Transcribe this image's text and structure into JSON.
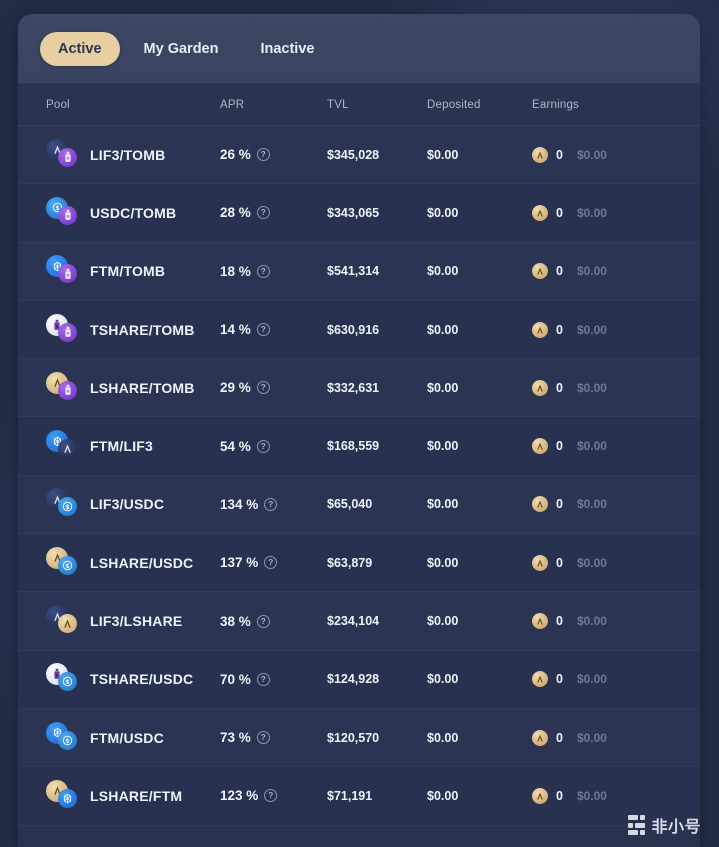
{
  "tabs": [
    {
      "label": "Active",
      "active": true
    },
    {
      "label": "My Garden",
      "active": false
    },
    {
      "label": "Inactive",
      "active": false
    }
  ],
  "table": {
    "headers": {
      "pool": "Pool",
      "apr": "APR",
      "tvl": "TVL",
      "deposited": "Deposited",
      "earnings": "Earnings"
    },
    "tooltip_glyph": "?",
    "rows": [
      {
        "pool": "LIF3/TOMB",
        "token_a": "lif3",
        "token_b": "tomb",
        "apr": "26 %",
        "tvl": "$345,028",
        "deposited": "$0.00",
        "earn_amount": "0",
        "earn_usd": "$0.00"
      },
      {
        "pool": "USDC/TOMB",
        "token_a": "usdc",
        "token_b": "tomb",
        "apr": "28 %",
        "tvl": "$343,065",
        "deposited": "$0.00",
        "earn_amount": "0",
        "earn_usd": "$0.00"
      },
      {
        "pool": "FTM/TOMB",
        "token_a": "ftm",
        "token_b": "tomb",
        "apr": "18 %",
        "tvl": "$541,314",
        "deposited": "$0.00",
        "earn_amount": "0",
        "earn_usd": "$0.00"
      },
      {
        "pool": "TSHARE/TOMB",
        "token_a": "tshare",
        "token_b": "tomb",
        "apr": "14 %",
        "tvl": "$630,916",
        "deposited": "$0.00",
        "earn_amount": "0",
        "earn_usd": "$0.00"
      },
      {
        "pool": "LSHARE/TOMB",
        "token_a": "lshare",
        "token_b": "tomb",
        "apr": "29 %",
        "tvl": "$332,631",
        "deposited": "$0.00",
        "earn_amount": "0",
        "earn_usd": "$0.00"
      },
      {
        "pool": "FTM/LIF3",
        "token_a": "ftm",
        "token_b": "lif3",
        "apr": "54 %",
        "tvl": "$168,559",
        "deposited": "$0.00",
        "earn_amount": "0",
        "earn_usd": "$0.00"
      },
      {
        "pool": "LIF3/USDC",
        "token_a": "lif3",
        "token_b": "usdc",
        "apr": "134 %",
        "tvl": "$65,040",
        "deposited": "$0.00",
        "earn_amount": "0",
        "earn_usd": "$0.00"
      },
      {
        "pool": "LSHARE/USDC",
        "token_a": "lshare",
        "token_b": "usdc",
        "apr": "137 %",
        "tvl": "$63,879",
        "deposited": "$0.00",
        "earn_amount": "0",
        "earn_usd": "$0.00"
      },
      {
        "pool": "LIF3/LSHARE",
        "token_a": "lif3",
        "token_b": "lshare",
        "apr": "38 %",
        "tvl": "$234,104",
        "deposited": "$0.00",
        "earn_amount": "0",
        "earn_usd": "$0.00"
      },
      {
        "pool": "TSHARE/USDC",
        "token_a": "tshare",
        "token_b": "usdc",
        "apr": "70 %",
        "tvl": "$124,928",
        "deposited": "$0.00",
        "earn_amount": "0",
        "earn_usd": "$0.00"
      },
      {
        "pool": "FTM/USDC",
        "token_a": "ftm",
        "token_b": "usdc",
        "apr": "73 %",
        "tvl": "$120,570",
        "deposited": "$0.00",
        "earn_amount": "0",
        "earn_usd": "$0.00"
      },
      {
        "pool": "LSHARE/FTM",
        "token_a": "lshare",
        "token_b": "ftm",
        "apr": "123 %",
        "tvl": "$71,191",
        "deposited": "$0.00",
        "earn_amount": "0",
        "earn_usd": "$0.00"
      }
    ]
  },
  "watermark": {
    "text": "非小号"
  },
  "colors": {
    "background": "#232c46",
    "card": "#29324f",
    "tabbar": "#3d4663",
    "accent_pill": "#e7cfa4",
    "row_odd": "#2b3453",
    "row_even": "#293150",
    "text_primary": "#eef2f9",
    "text_muted": "#aeb7ca",
    "text_dim": "#6f7a93",
    "token_lif3": "#3c4f86",
    "token_tomb": "#8b4fd8",
    "token_usdc": "#2f8fe0",
    "token_ftm": "#1f7af0",
    "token_tshare": "#e8ecf5",
    "token_lshare": "#d4ae72"
  }
}
